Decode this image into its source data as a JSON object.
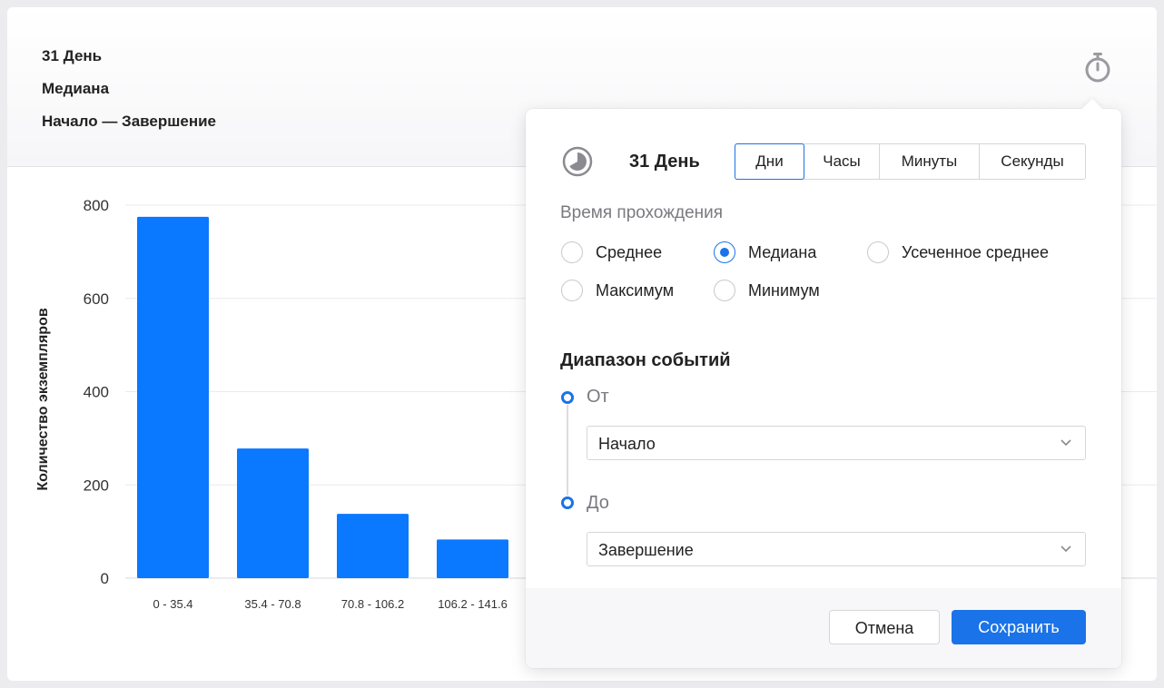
{
  "header": {
    "period": "31 День",
    "metric": "Медиана",
    "range": "Начало — Завершение"
  },
  "icons": {
    "stopwatch": "stopwatch-icon",
    "clock": "clock-pie-icon",
    "chevron": "chevron-down-icon"
  },
  "colors": {
    "accent": "#1a73e8",
    "bar": "#0a78ff"
  },
  "chart_data": {
    "type": "bar",
    "categories": [
      "0 - 35.4",
      "35.4 - 70.8",
      "70.8 - 106.2",
      "106.2 - 141.6"
    ],
    "values": [
      775,
      278,
      138,
      83
    ],
    "ylabel": "Количество экземпляров",
    "xlabel": "",
    "ylim": [
      0,
      800
    ],
    "yticks": [
      0,
      200,
      400,
      600,
      800
    ],
    "grid": true
  },
  "popover": {
    "title": "31 День",
    "units": [
      {
        "label": "Дни",
        "active": true
      },
      {
        "label": "Часы",
        "active": false
      },
      {
        "label": "Минуты",
        "active": false
      },
      {
        "label": "Секунды",
        "active": false
      }
    ],
    "time_label": "Время прохождения",
    "options": [
      {
        "label": "Среднее",
        "selected": false
      },
      {
        "label": "Медиана",
        "selected": true
      },
      {
        "label": "Усеченное среднее",
        "selected": false
      },
      {
        "label": "Максимум",
        "selected": false
      },
      {
        "label": "Минимум",
        "selected": false
      }
    ],
    "range_title": "Диапазон событий",
    "from_label": "От",
    "from_value": "Начало",
    "to_label": "До",
    "to_value": "Завершение",
    "cancel_label": "Отмена",
    "save_label": "Сохранить"
  }
}
